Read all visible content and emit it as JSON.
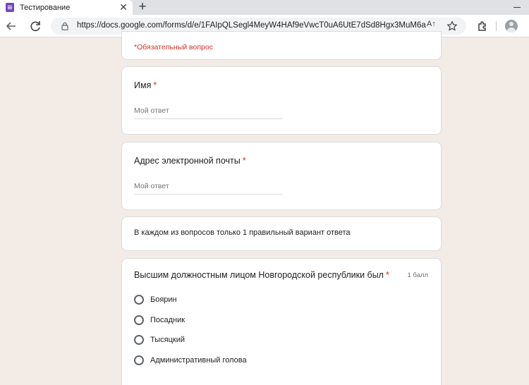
{
  "browser": {
    "tab_title": "Тестирование",
    "tab_close": "✕",
    "new_tab": "+",
    "url": "https://docs.google.com/forms/d/e/1FAIpQLSegl4MeyW4HAf9eVwcT0uA6UtE7dSd8Hgx3MuM6a...",
    "read_aloud": "A↑"
  },
  "form": {
    "required_note": "*Обязательный вопрос",
    "name_question": {
      "title": "Имя",
      "required_mark": "*",
      "placeholder": "Мой ответ"
    },
    "email_question": {
      "title": "Адрес электронной почты",
      "required_mark": "*",
      "placeholder": "Мой ответ"
    },
    "info_text": "В каждом из вопросов только 1 правильный вариант ответа",
    "question1": {
      "title": "Высшим должностным лицом Новгородской республики был",
      "required_mark": "*",
      "points": "1 балл",
      "options": [
        "Боярин",
        "Посадник",
        "Тысяцкий",
        "Административный голова"
      ]
    }
  },
  "colors": {
    "background": "#f3ebe6",
    "required": "#d93025",
    "accent": "#7248b9"
  }
}
